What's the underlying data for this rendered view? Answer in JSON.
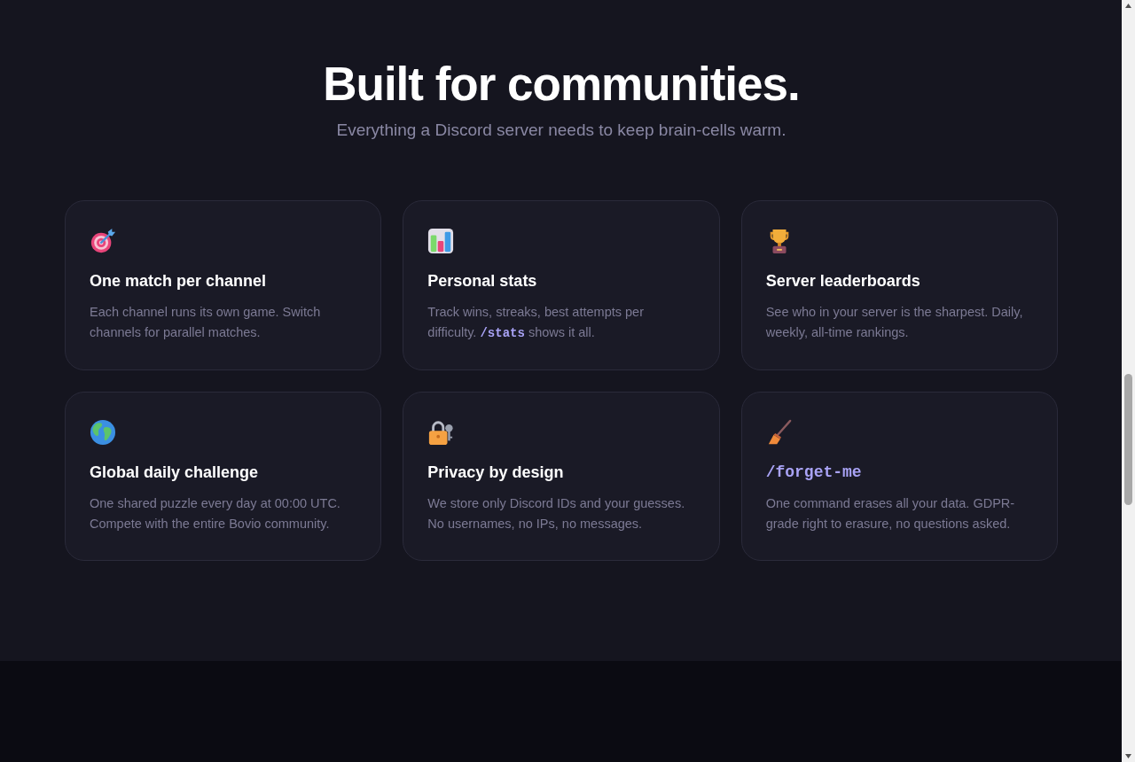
{
  "heading": "Built for communities.",
  "subheading": "Everything a Discord server needs to keep brain-cells warm.",
  "features": [
    {
      "kind": "plain",
      "title": "One match per channel",
      "description": [
        {
          "kind": "text",
          "text": "Each channel runs its own game. Switch channels for parallel matches."
        }
      ]
    },
    {
      "kind": "plain",
      "title": "Personal stats",
      "description": [
        {
          "kind": "text",
          "text": "Track wins, streaks, best attempts per difficulty. "
        },
        {
          "kind": "code",
          "text": "/stats"
        },
        {
          "kind": "text",
          "text": " shows it all."
        }
      ]
    },
    {
      "kind": "plain",
      "title": "Server leaderboards",
      "description": [
        {
          "kind": "text",
          "text": "See who in your server is the sharpest. Daily, weekly, all-time rankings."
        }
      ]
    },
    {
      "kind": "plain",
      "title": "Global daily challenge",
      "description": [
        {
          "kind": "text",
          "text": "One shared puzzle every day at 00:00 UTC. Compete with the entire Bovio community."
        }
      ]
    },
    {
      "kind": "plain",
      "title": "Privacy by design",
      "description": [
        {
          "kind": "text",
          "text": "We store only Discord IDs and your guesses. No usernames, no IPs, no messages."
        }
      ]
    },
    {
      "kind": "command",
      "title": "/forget-me",
      "description": [
        {
          "kind": "text",
          "text": "One command erases all your data. GDPR-grade right to erasure, no questions asked."
        }
      ]
    }
  ]
}
